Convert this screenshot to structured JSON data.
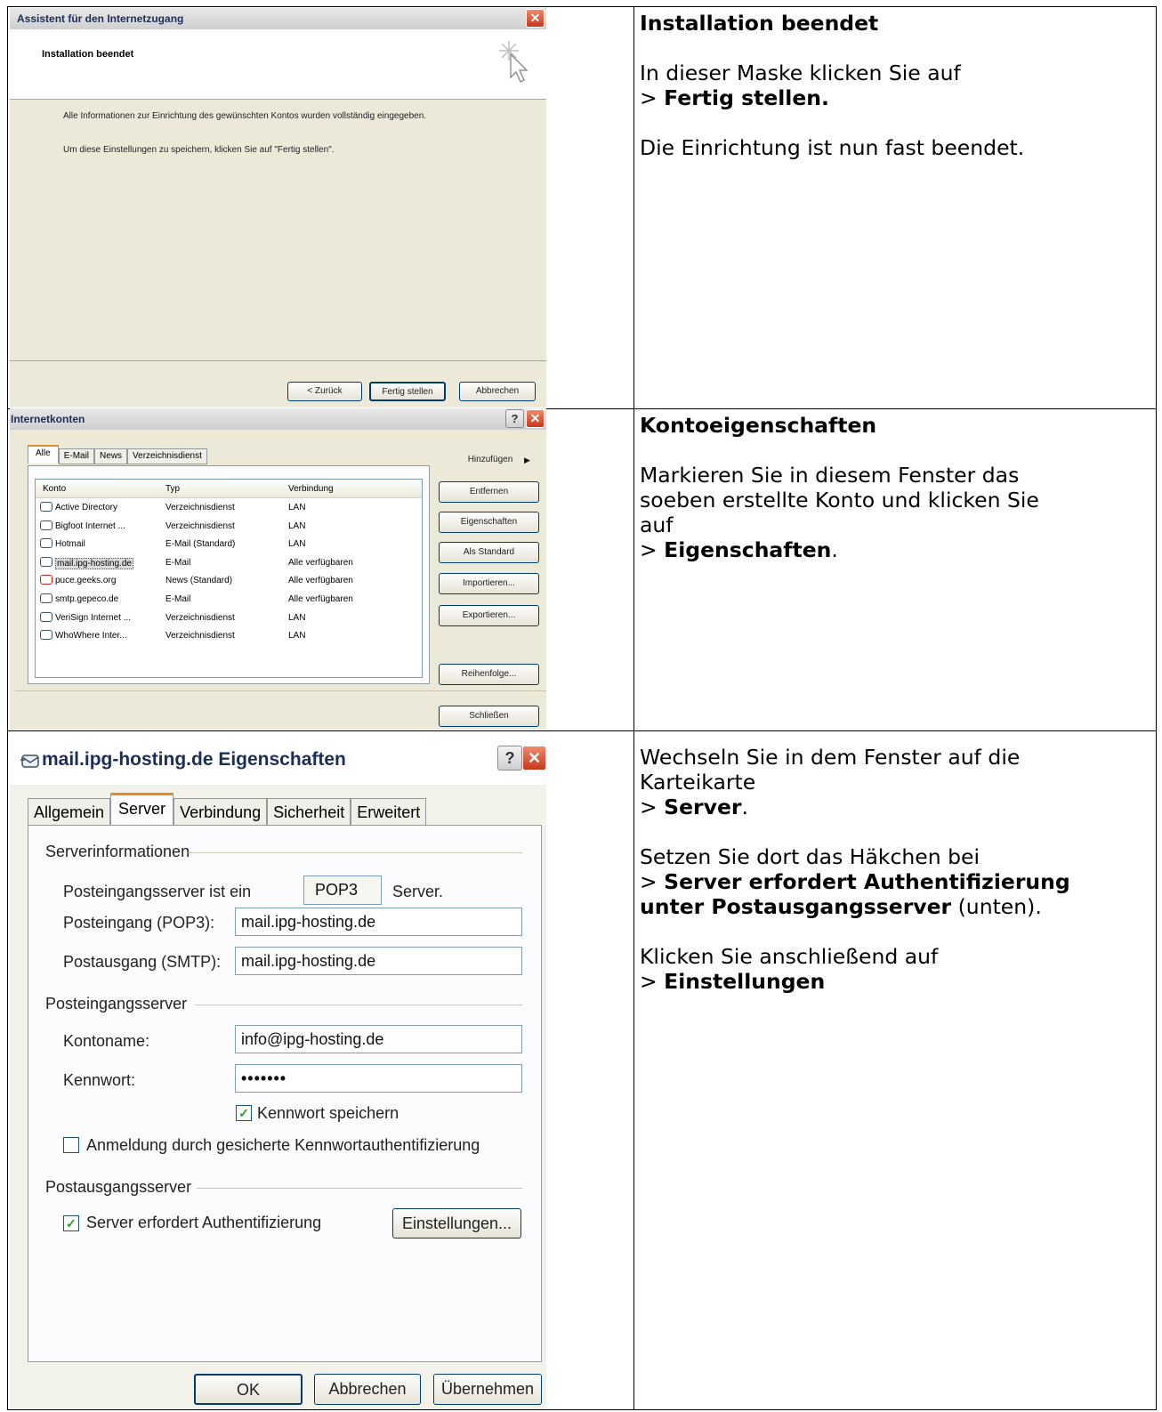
{
  "steps": [
    {
      "window": {
        "title": "Assistent für den Internetzugang",
        "header": "Installation beendet",
        "text1": "Alle Informationen zur Einrichtung des gewünschten Kontos wurden vollständig eingegeben.",
        "text2": "Um diese Einstellungen zu speichern, klicken Sie auf \"Fertig stellen\".",
        "btn_back": "< Zurück",
        "btn_finish": "Fertig stellen",
        "btn_cancel": "Abbrechen"
      },
      "title": "Installation beendet",
      "line1": "In dieser Maske klicken Sie auf",
      "prefix": "> ",
      "bold": "Fertig stellen.",
      "line3": "Die Einrichtung ist nun fast beendet."
    },
    {
      "window": {
        "title": "Internetkonten",
        "help": "?",
        "tabs": [
          "Alle",
          "E-Mail",
          "News",
          "Verzeichnisdienst"
        ],
        "columns": [
          "Konto",
          "Typ",
          "Verbindung"
        ],
        "rows": [
          [
            "Active Directory",
            "Verzeichnisdienst",
            "LAN"
          ],
          [
            "Bigfoot Internet ...",
            "Verzeichnisdienst",
            "LAN"
          ],
          [
            "Hotmail",
            "E-Mail (Standard)",
            "LAN"
          ],
          [
            "mail.ipg-hosting.de",
            "E-Mail",
            "Alle verfügbaren"
          ],
          [
            "puce.geeks.org",
            "News (Standard)",
            "Alle verfügbaren"
          ],
          [
            "smtp.gepeco.de",
            "E-Mail",
            "Alle verfügbaren"
          ],
          [
            "VeriSign Internet ...",
            "Verzeichnisdienst",
            "LAN"
          ],
          [
            "WhoWhere Inter...",
            "Verzeichnisdienst",
            "LAN"
          ]
        ],
        "buttons": [
          "Hinzufügen",
          "Entfernen",
          "Eigenschaften",
          "Als Standard",
          "Importieren...",
          "Exportieren...",
          "Reihenfolge...",
          "Schließen"
        ]
      },
      "title": "Kontoeigenschaften",
      "line1": "Markieren Sie in diesem Fenster das",
      "line2": "soeben erstellte Konto und klicken Sie",
      "line3": "auf",
      "prefix": "> ",
      "bold": "Eigenschaften",
      "suffix": "."
    },
    {
      "window": {
        "title": "mail.ipg-hosting.de Eigenschaften",
        "help": "?",
        "tabs": [
          "Allgemein",
          "Server",
          "Verbindung",
          "Sicherheit",
          "Erweitert"
        ],
        "group_info": "Serverinformationen",
        "incoming_type_label": "Posteingangsserver ist ein",
        "incoming_type": "POP3",
        "server_word": "Server.",
        "pop3_label": "Posteingang (POP3):",
        "pop3_value": "mail.ipg-hosting.de",
        "smtp_label": "Postausgang (SMTP):",
        "smtp_value": "mail.ipg-hosting.de",
        "group_in": "Posteingangsserver",
        "account_label": "Kontoname:",
        "account_value": "info@ipg-hosting.de",
        "password_label": "Kennwort:",
        "password_value": "•••••••",
        "save_password": "Kennwort speichern",
        "spa": "Anmeldung durch gesicherte Kennwortauthentifizierung",
        "group_out": "Postausgangsserver",
        "auth": "Server erfordert Authentifizierung",
        "settings_btn": "Einstellungen...",
        "ok": "OK",
        "cancel": "Abbrechen",
        "apply": "Übernehmen"
      },
      "line1": "Wechseln Sie in dem Fenster auf die",
      "line2": "Karteikarte",
      "prefix": "> ",
      "bold1": "Server",
      "suffix1": ".",
      "line4": "Setzen Sie dort das Häkchen bei",
      "bold2a": "Server erfordert Authentifizierung",
      "bold2b": "unter Postausgangsserver",
      "suffix2": " (unten).",
      "line7": "Klicken Sie anschließend auf",
      "bold3": "Einstellungen"
    }
  ]
}
